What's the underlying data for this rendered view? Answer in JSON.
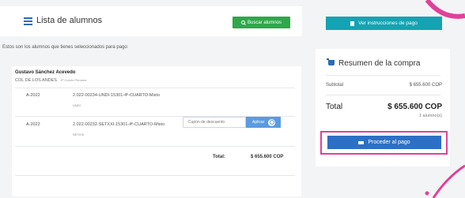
{
  "header": {
    "title": "Lista de alumnos",
    "search_button": "Buscar alumnos"
  },
  "intro_text": "Estos son los alumnos que tienes seleccionados para pago:",
  "student": {
    "name": "Gustavo Sánchez Acevedo",
    "school": "COL DE LOS ANDES",
    "grade": "4º Cuarto Primaria",
    "items": [
      {
        "year": "A-2022",
        "code": "2.022-00234-UNDI-15301-4º-CUARTO-Mixto",
        "sub": "UNDI"
      },
      {
        "year": "A-2022",
        "code": "2.022-00232-SETXXI-15301-4º-CUARTO-Mixto",
        "sub": "SETXXI"
      }
    ],
    "total_label": "Total:",
    "total_value": "$ 655.600 COP"
  },
  "coupon": {
    "placeholder": "Cupón de descuento",
    "apply_label": "Aplicar"
  },
  "instructions_button": "Ver instrucciones de pago",
  "summary": {
    "title": "Resumen de la compra",
    "subtotal_label": "Subtotal",
    "subtotal_value": "$ 655.600 COP",
    "total_label": "Total",
    "total_value": "$ 655.600 COP",
    "count": "1 alumno(s)",
    "proceed_button": "Proceder al pago"
  },
  "colors": {
    "primary_blue": "#2c70c5",
    "success_green": "#2ea84a",
    "teal": "#14a3b3",
    "highlight_pink": "#e0419a"
  }
}
